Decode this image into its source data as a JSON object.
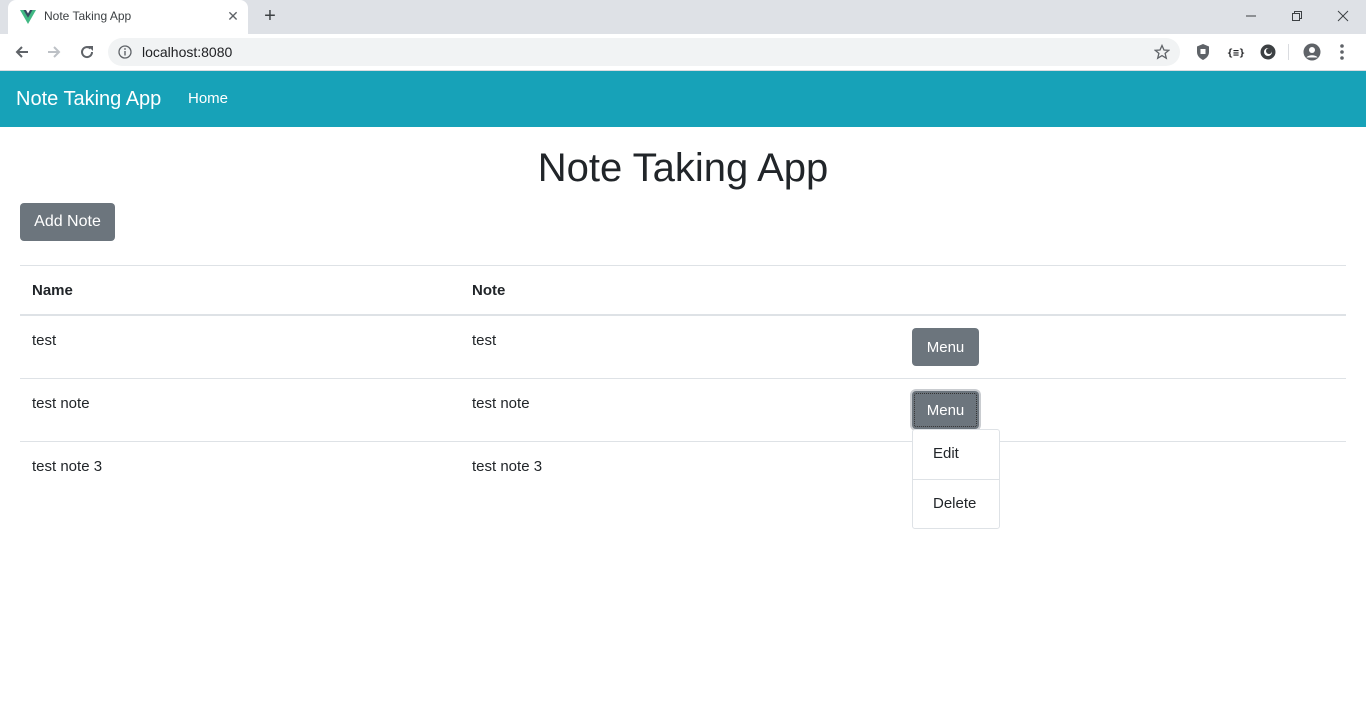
{
  "browser": {
    "tab_title": "Note Taking App",
    "url": "localhost:8080",
    "new_tab_label": "+",
    "close_tab_label": "✕"
  },
  "navbar": {
    "brand": "Note Taking App",
    "home_link": "Home",
    "color": "#17a2b8"
  },
  "main": {
    "title": "Note Taking App",
    "add_note_label": "Add Note",
    "table": {
      "headers": [
        "Name",
        "Note",
        ""
      ],
      "rows": [
        {
          "name": "test",
          "note": "test",
          "action": "Menu"
        },
        {
          "name": "test note",
          "note": "test note",
          "action": "Menu"
        },
        {
          "name": "test note 3",
          "note": "test note 3",
          "action": ""
        }
      ]
    },
    "dropdown": {
      "items": [
        "Edit",
        "Delete"
      ]
    }
  }
}
